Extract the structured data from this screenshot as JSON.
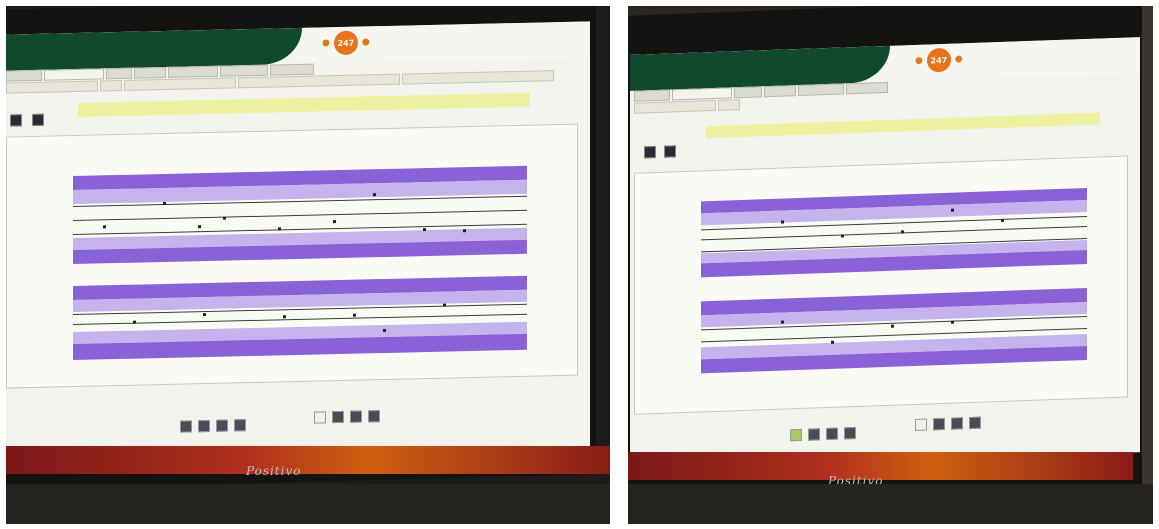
{
  "photos": [
    {
      "id": "left",
      "monitor_brand": "Positivo",
      "logo_number": "247"
    },
    {
      "id": "right",
      "monitor_brand": "Positivo",
      "logo_number": "247"
    }
  ],
  "colors": {
    "banner": "#0f4a2c",
    "logo_orange": "#e8731a",
    "band_dark": "#8a62d8",
    "band_light": "#c6b2ec",
    "filter_bar": "#eef0a0",
    "taskbar": "#b0301c"
  }
}
